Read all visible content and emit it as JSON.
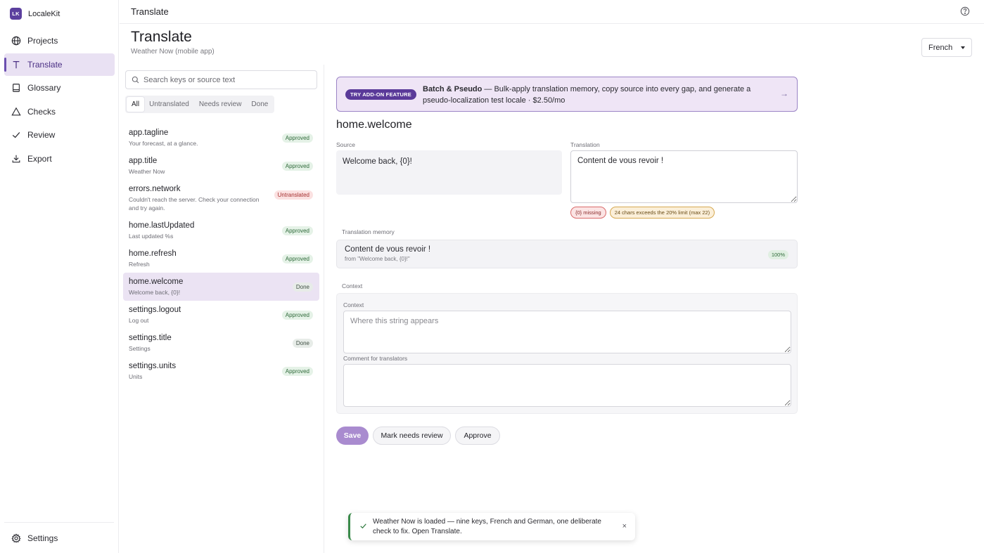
{
  "brand": {
    "logo": "LK",
    "name": "LocaleKit"
  },
  "nav": [
    {
      "label": "Projects",
      "icon": "globe-icon"
    },
    {
      "label": "Translate",
      "icon": "text-icon",
      "active": true
    },
    {
      "label": "Glossary",
      "icon": "book-icon"
    },
    {
      "label": "Checks",
      "icon": "warning-icon"
    },
    {
      "label": "Review",
      "icon": "check-icon"
    },
    {
      "label": "Export",
      "icon": "download-icon"
    }
  ],
  "settings_label": "Settings",
  "topbar": {
    "title": "Translate",
    "help_icon": "help-icon"
  },
  "page": {
    "title": "Translate",
    "subtitle": "Weather Now (mobile app)",
    "language": "French"
  },
  "search": {
    "placeholder": "Search keys or source text"
  },
  "tabs": [
    {
      "label": "All",
      "active": true
    },
    {
      "label": "Untranslated"
    },
    {
      "label": "Needs review"
    },
    {
      "label": "Done"
    }
  ],
  "keys": [
    {
      "name": "app.tagline",
      "source": "Your forecast, at a glance.",
      "status": "Approved"
    },
    {
      "name": "app.title",
      "source": "Weather Now",
      "status": "Approved"
    },
    {
      "name": "errors.network",
      "source": "Couldn't reach the server. Check your connection and try again.",
      "status": "Untranslated"
    },
    {
      "name": "home.lastUpdated",
      "source": "Last updated %s",
      "status": "Approved"
    },
    {
      "name": "home.refresh",
      "source": "Refresh",
      "status": "Approved"
    },
    {
      "name": "home.welcome",
      "source": "Welcome back, {0}!",
      "status": "Done"
    },
    {
      "name": "settings.logout",
      "source": "Log out",
      "status": "Approved"
    },
    {
      "name": "settings.title",
      "source": "Settings",
      "status": "Done"
    },
    {
      "name": "settings.units",
      "source": "Units",
      "status": "Approved"
    }
  ],
  "promo": {
    "chip": "TRY ADD-ON FEATURE",
    "title": "Batch & Pseudo",
    "text": " — Bulk-apply translation memory, copy source into every gap, and generate a pseudo-localization test locale · $2.50/mo",
    "arrow": "→"
  },
  "editor": {
    "key": "home.welcome",
    "source_label": "Source",
    "source": "Welcome back, {0}!",
    "translation_label": "Translation",
    "translation": "Content de vous revoir !",
    "issues": [
      "{0} missing",
      "24 chars exceeds the 20% limit (max 22)"
    ],
    "tm_label": "Translation memory",
    "tm_text": "Content de vous revoir !",
    "tm_from": "from \"Welcome back, {0}!\"",
    "tm_score": "100%",
    "context_section": "Context",
    "context_label": "Context",
    "context_placeholder": "Where this string appears",
    "comment_label": "Comment for translators",
    "buttons": {
      "save": "Save",
      "needs_review": "Mark needs review",
      "approve": "Approve"
    }
  },
  "toast": {
    "text": "Weather Now is loaded — nine keys, French and German, one deliberate check to fix. Open Translate.",
    "close": "×"
  }
}
